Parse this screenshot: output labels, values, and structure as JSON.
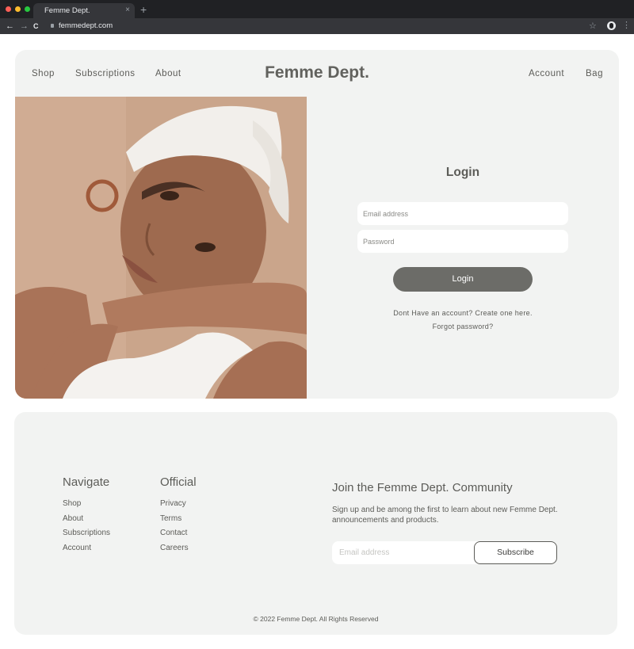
{
  "browser": {
    "tab_title": "Femme Dept.",
    "tab_close": "×",
    "new_tab": "+",
    "url": "femmedept.com",
    "icons": {
      "back": "←",
      "forward": "→",
      "reload": "C",
      "star": "☆",
      "menu": "⋮"
    },
    "traffic_lights": [
      "#ff5f57",
      "#febc2e",
      "#28c840"
    ]
  },
  "header": {
    "nav_left": [
      "Shop",
      "Subscriptions",
      "About"
    ],
    "brand": "Femme Dept.",
    "nav_right": [
      "Account",
      "Bag"
    ]
  },
  "login": {
    "title": "Login",
    "email_placeholder": "Email address",
    "password_placeholder": "Password",
    "submit_label": "Login",
    "create_account": "Dont Have an account? Create one here.",
    "forgot_password": "Forgot password?"
  },
  "footer": {
    "navigate": {
      "heading": "Navigate",
      "links": [
        "Shop",
        "About",
        "Subscriptions",
        "Account"
      ]
    },
    "official": {
      "heading": "Official",
      "links": [
        "Privacy",
        "Terms",
        "Contact",
        "Careers"
      ]
    },
    "newsletter": {
      "heading": "Join the Femme Dept. Community",
      "subtext": "Sign up and be among the first to learn about new Femme Dept. announcements and products.",
      "email_placeholder": "Email address",
      "button_label": "Subscribe"
    },
    "copyright": "© 2022 Femme Dept. All Rights Reserved"
  },
  "colors": {
    "card_bg": "#f2f3f2",
    "text": "#5c5c58",
    "button_bg": "#6c6c68"
  }
}
